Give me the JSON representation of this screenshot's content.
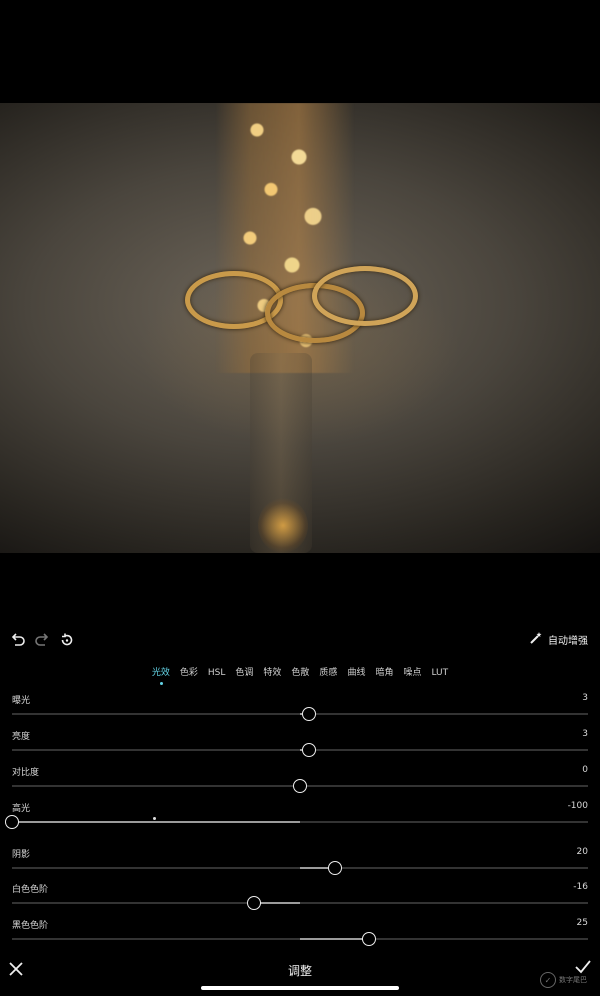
{
  "toolbar": {
    "auto_enhance_label": "自动增强"
  },
  "tabs": [
    {
      "label": "光效",
      "active": true
    },
    {
      "label": "色彩",
      "active": false
    },
    {
      "label": "HSL",
      "active": false
    },
    {
      "label": "色调",
      "active": false
    },
    {
      "label": "特效",
      "active": false
    },
    {
      "label": "色散",
      "active": false
    },
    {
      "label": "质感",
      "active": false
    },
    {
      "label": "曲线",
      "active": false
    },
    {
      "label": "暗角",
      "active": false
    },
    {
      "label": "噪点",
      "active": false
    },
    {
      "label": "LUT",
      "active": false
    }
  ],
  "sliders": [
    {
      "label": "曝光",
      "value": "3",
      "position": 0.515
    },
    {
      "label": "亮度",
      "value": "3",
      "position": 0.515
    },
    {
      "label": "对比度",
      "value": "0",
      "position": 0.5
    },
    {
      "label": "高光",
      "value": "-100",
      "position": 0.0
    },
    {
      "label": "阴影",
      "value": "20",
      "position": 0.56
    },
    {
      "label": "白色色阶",
      "value": "-16",
      "position": 0.42
    },
    {
      "label": "黑色色阶",
      "value": "25",
      "position": 0.62
    }
  ],
  "bottom": {
    "title": "调整",
    "watermark": "数字尾巴"
  },
  "colors": {
    "accent": "#63d4e6",
    "background": "#000000"
  },
  "icons": [
    "undo-icon",
    "redo-icon",
    "reset-icon",
    "magic-wand-icon",
    "close-icon",
    "check-icon"
  ]
}
